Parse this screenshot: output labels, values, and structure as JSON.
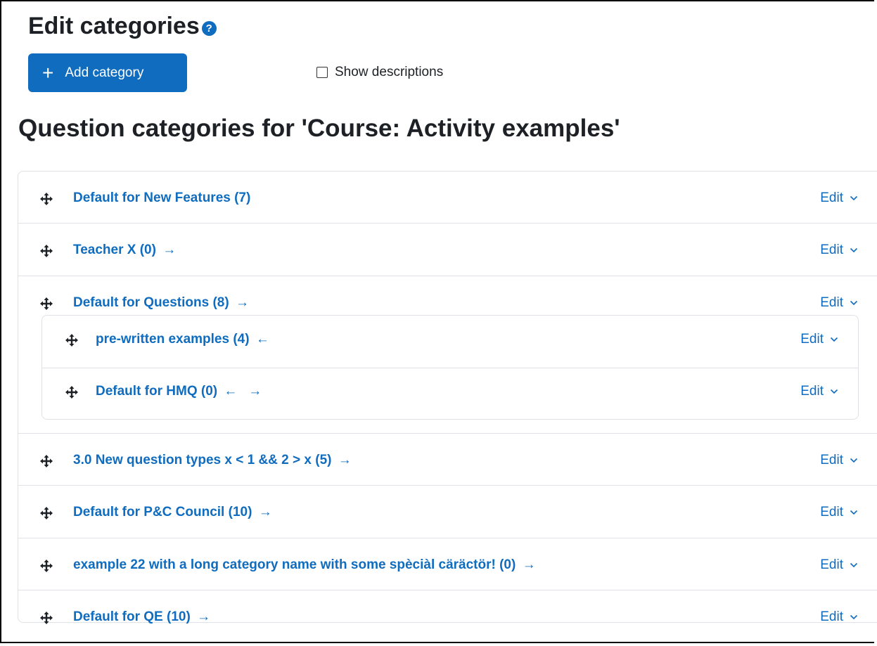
{
  "page": {
    "title": "Edit categories",
    "add_button_label": "Add category",
    "show_descriptions_label": "Show descriptions",
    "section_title": "Question categories for 'Course: Activity examples'"
  },
  "icons": {
    "help": "help-icon",
    "plus": "plus-icon",
    "move": "move-icon",
    "chevron": "chevron-down-icon"
  },
  "colors": {
    "accent": "#0f6cbf",
    "border": "#dee2e6",
    "text": "#1d2125"
  },
  "edit_label": "Edit",
  "categories": [
    {
      "name": "Default for New Features (7)",
      "arrows": ""
    },
    {
      "name": "Teacher X (0)",
      "arrows": "→"
    },
    {
      "name": "Default for Questions (8)",
      "arrows": "→",
      "children": [
        {
          "name": "pre-written examples (4)",
          "arrows": "←"
        },
        {
          "name": "Default for HMQ (0)",
          "arrows": "←   →"
        }
      ]
    },
    {
      "name": "3.0 New question types x < 1 && 2 > x (5)",
      "arrows": "→"
    },
    {
      "name": "Default for P&C Council (10)",
      "arrows": "→"
    },
    {
      "name": "example 22 with a long category name with some spèciàl cäräctör! (0)",
      "arrows": "→"
    },
    {
      "name": "Default for QE (10)",
      "arrows": "→"
    }
  ]
}
